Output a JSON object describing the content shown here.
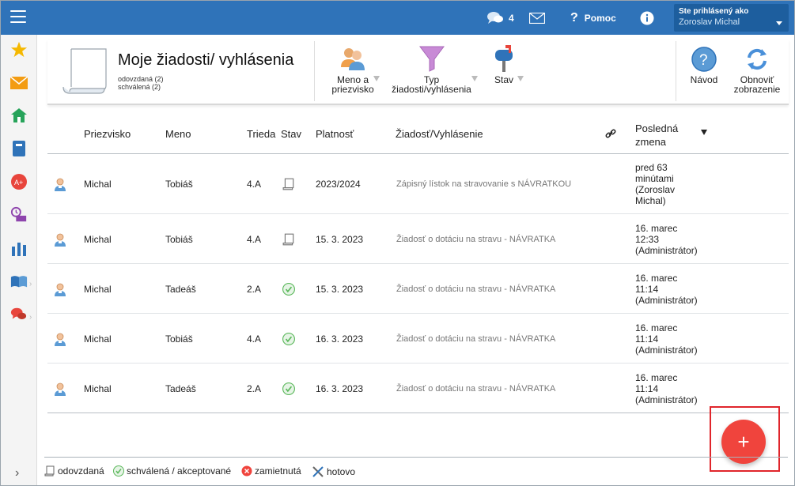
{
  "topbar": {
    "messages_count": "4",
    "help_label": "Pomoc",
    "user_label": "Ste prihlásený ako",
    "user_name": "Zoroslav Michal"
  },
  "header": {
    "title": "Moje žiadosti/ vyhlásenia",
    "legend_line1": "odovzdaná (2)",
    "legend_line2": "schválená (2)",
    "tools": {
      "name_line1": "Meno a",
      "name_line2": "priezvisko",
      "type_line1": "Typ",
      "type_line2": "žiadosti/vyhlásenia",
      "state": "Stav",
      "guide": "Návod",
      "refresh_line1": "Obnoviť",
      "refresh_line2": "zobrazenie"
    }
  },
  "table": {
    "headers": {
      "surname": "Priezvisko",
      "name": "Meno",
      "class": "Trieda",
      "state": "Stav",
      "validity": "Platnosť",
      "request": "Žiadosť/Vyhlásenie",
      "last_change_1": "Posledná",
      "last_change_2": "zmena"
    },
    "rows": [
      {
        "surname": "Michal",
        "name": "Tobiáš",
        "class": "4.A",
        "state": "odovzdana",
        "validity": "2023/2024",
        "request": "Zápisný lístok na stravovanie s NÁVRATKOU",
        "change": [
          "pred 63",
          "minútami",
          "(Zoroslav",
          "Michal)"
        ]
      },
      {
        "surname": "Michal",
        "name": "Tobiáš",
        "class": "4.A",
        "state": "odovzdana",
        "validity": "15. 3. 2023",
        "request": "Žiadosť o dotáciu na stravu - NÁVRATKA",
        "change": [
          "16. marec",
          "12:33",
          "(Administrátor)",
          ""
        ]
      },
      {
        "surname": "Michal",
        "name": "Tadeáš",
        "class": "2.A",
        "state": "schvalena",
        "validity": "15. 3. 2023",
        "request": "Žiadosť o dotáciu na stravu - NÁVRATKA",
        "change": [
          "16. marec",
          "11:14",
          "(Administrátor)",
          ""
        ]
      },
      {
        "surname": "Michal",
        "name": "Tobiáš",
        "class": "4.A",
        "state": "schvalena",
        "validity": "16. 3. 2023",
        "request": "Žiadosť o dotáciu na stravu - NÁVRATKA",
        "change": [
          "16. marec",
          "11:14",
          "(Administrátor)",
          ""
        ]
      },
      {
        "surname": "Michal",
        "name": "Tadeáš",
        "class": "2.A",
        "state": "schvalena",
        "validity": "16. 3. 2023",
        "request": "Žiadosť o dotáciu na stravu - NÁVRATKA",
        "change": [
          "16. marec",
          "11:14",
          "(Administrátor)",
          ""
        ]
      }
    ]
  },
  "fab": {
    "label": "+"
  },
  "legend": {
    "submitted": "odovzdaná",
    "approved": "schválená / akceptované",
    "rejected": "zamietnutá",
    "done": "hotovo"
  },
  "colors": {
    "topbar": "#2f73b9",
    "accent_red": "#f0443d",
    "approved_green": "#5cb85c"
  }
}
